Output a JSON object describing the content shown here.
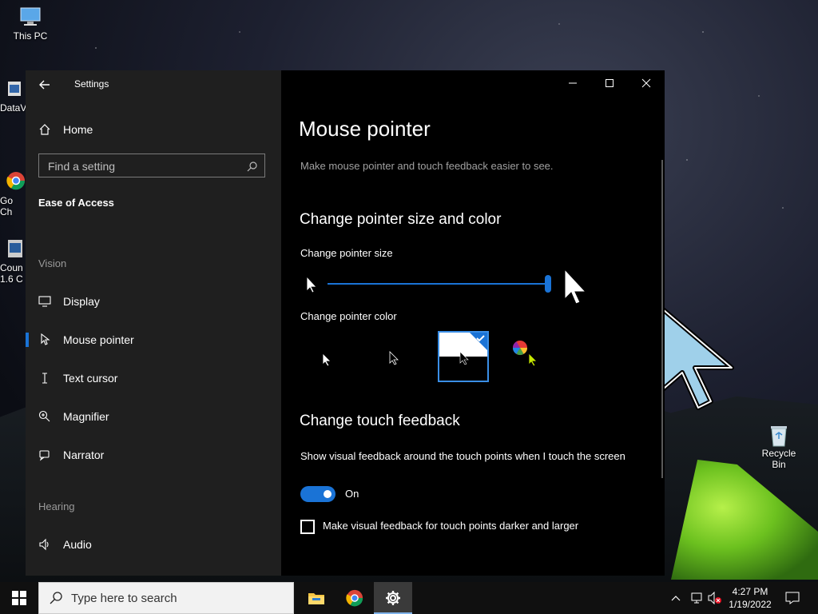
{
  "desktop": {
    "icons": [
      {
        "label": "This PC"
      },
      {
        "label": "DataV"
      },
      {
        "label": "Go\nCh"
      },
      {
        "label": "Coun\n1.6 C"
      },
      {
        "label": "Recycle Bin"
      }
    ]
  },
  "window": {
    "title": "Settings",
    "home_label": "Home",
    "search_placeholder": "Find a setting",
    "section_title": "Ease of Access",
    "vision_label": "Vision",
    "vision_items": [
      {
        "label": "Display",
        "icon": "monitor-icon"
      },
      {
        "label": "Mouse pointer",
        "icon": "mouse-pointer-icon"
      },
      {
        "label": "Text cursor",
        "icon": "text-cursor-icon"
      },
      {
        "label": "Magnifier",
        "icon": "magnifier-icon"
      },
      {
        "label": "Narrator",
        "icon": "narrator-icon"
      }
    ],
    "hearing_label": "Hearing",
    "hearing_items": [
      {
        "label": "Audio",
        "icon": "speaker-icon"
      }
    ],
    "active_item": "Mouse pointer"
  },
  "main": {
    "title": "Mouse pointer",
    "description": "Make mouse pointer and touch feedback easier to see.",
    "size_color_heading": "Change pointer size and color",
    "size_label": "Change pointer size",
    "size_level_fraction": 1.0,
    "color_label": "Change pointer color",
    "color_options": [
      "white",
      "black",
      "inverted",
      "custom"
    ],
    "selected_color": "inverted",
    "touch_heading": "Change touch feedback",
    "touch_desc": "Show visual feedback around the touch points when I touch the screen",
    "toggle_state": "On",
    "checkbox_label": "Make visual feedback for touch points darker and larger",
    "checkbox_checked": false
  },
  "taskbar": {
    "search_placeholder": "Type here to search",
    "time": "4:27 PM",
    "date": "1/19/2022"
  },
  "colors": {
    "accent": "#1a73d6",
    "sidebar_bg": "#1f1f1f",
    "content_bg": "#000000"
  }
}
